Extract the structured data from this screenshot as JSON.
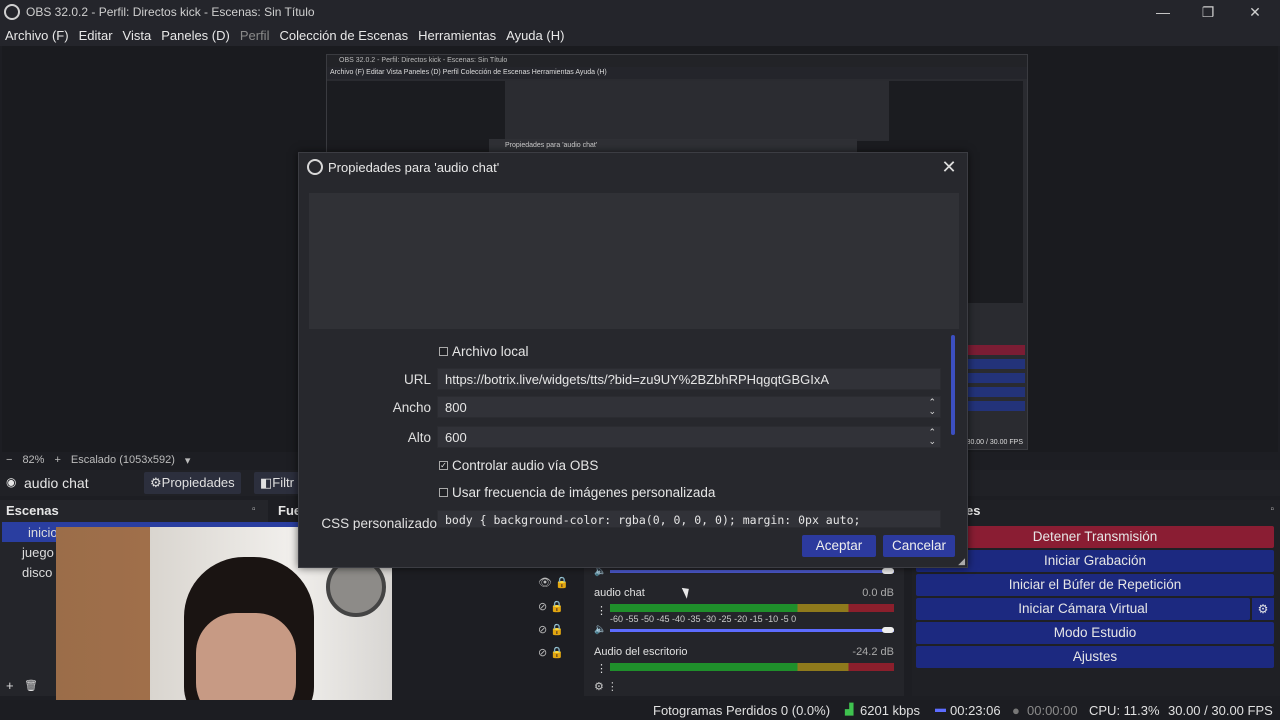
{
  "app": {
    "title": "OBS 32.0.2 - Perfil: Directos kick - Escenas: Sin Título"
  },
  "menu": [
    {
      "label": "Archivo (F)"
    },
    {
      "label": "Editar"
    },
    {
      "label": "Vista"
    },
    {
      "label": "Paneles (D)"
    },
    {
      "label": "Perfil"
    },
    {
      "label": "Colección de Escenas"
    },
    {
      "label": "Herramientas"
    },
    {
      "label": "Ayuda (H)"
    }
  ],
  "nested_preview": {
    "title": "OBS 32.0.2 - Perfil: Directos kick - Escenas: Sin Título",
    "menu": "Archivo (F)  Editar  Vista  Paneles (D)  Perfil  Colección de Escenas  Herramientas  Ayuda (H)",
    "dialog_title": "Propiedades para 'audio chat'",
    "fps": "30.00 / 30.00 FPS"
  },
  "zoombar": {
    "zoom": "82%",
    "plus": "+",
    "scaling": "Escalado (1053x592)"
  },
  "sourcebar": {
    "source_name": "audio chat",
    "properties": "Propiedades",
    "filters": "Filtr"
  },
  "scenes": {
    "title": "Escenas",
    "items": [
      "inicio",
      "juego",
      "disco"
    ]
  },
  "sources_title": "Fue",
  "controls": {
    "title": "es",
    "buttons": [
      "Detener Transmisión",
      "Iniciar Grabación",
      "Iniciar el Búfer de Repetición",
      "Iniciar Cámara Virtual",
      "Modo Estudio",
      "Ajustes"
    ]
  },
  "mixer": {
    "channels": [
      {
        "name": "audio chat",
        "db": "0.0 dB"
      },
      {
        "name": "Audio del escritorio",
        "db": "-24.2 dB"
      }
    ],
    "scale": "-60 -55 -50 -45 -40 -35 -30 -25 -20 -15 -10  -5   0"
  },
  "dialog": {
    "title": "Propiedades para 'audio chat'",
    "local_file": "Archivo local",
    "url_label": "URL",
    "url": "https://botrix.live/widgets/tts/?bid=zu9UY%2BZbhRPHqgqtGBGIxA",
    "width_label": "Ancho",
    "width": "800",
    "height_label": "Alto",
    "height": "600",
    "control_audio": "Controlar audio vía OBS",
    "custom_fps": "Usar frecuencia de imágenes personalizada",
    "css_label": "CSS personalizado",
    "css": "body { background-color: rgba(0, 0, 0, 0); margin: 0px auto;",
    "accept": "Aceptar",
    "cancel": "Cancelar"
  },
  "status": {
    "dropped": "Fotogramas Perdidos 0 (0.0%)",
    "kbps": "6201 kbps",
    "stream_time": "00:23:06",
    "rec_time": "00:00:00",
    "cpu": "CPU: 11.3%",
    "fps": "30.00 / 30.00 FPS"
  }
}
